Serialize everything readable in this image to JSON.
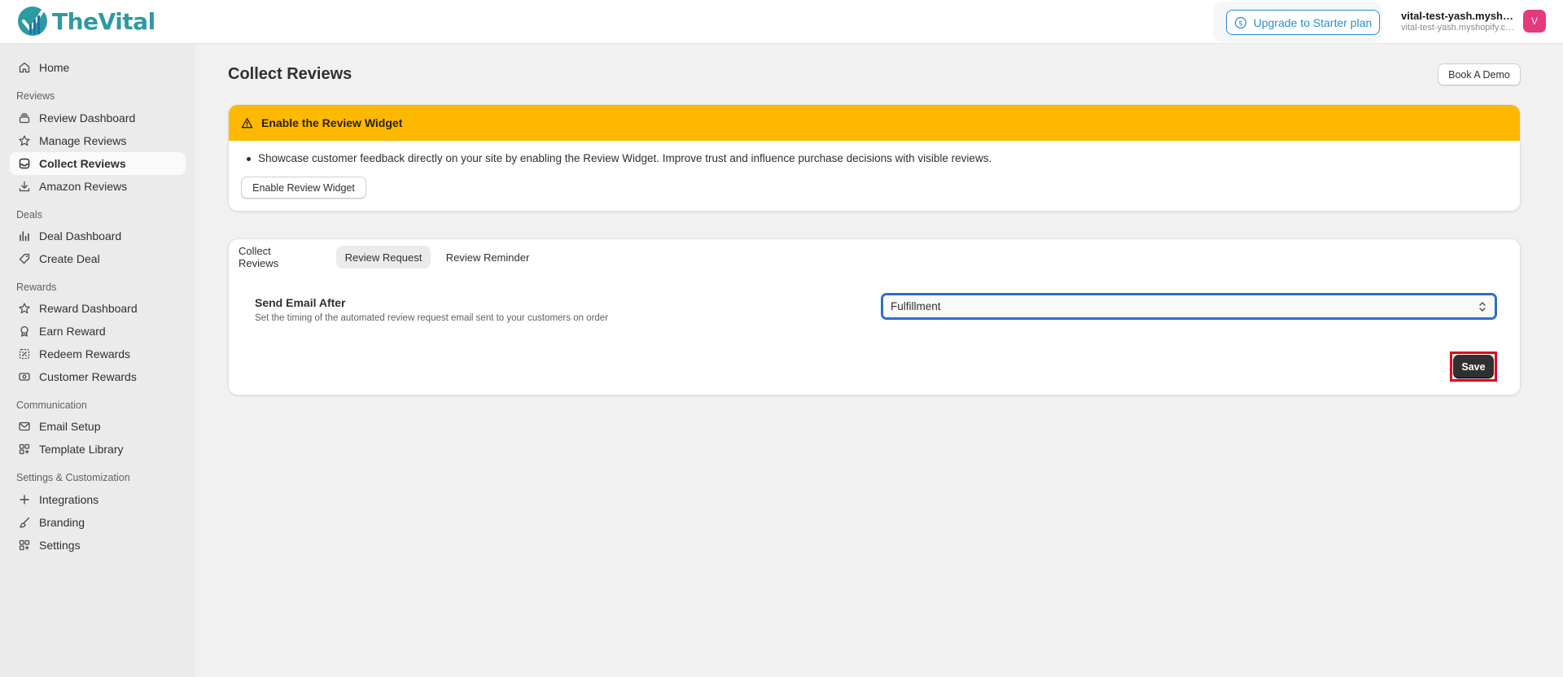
{
  "app": {
    "name": "TheVital"
  },
  "topbar": {
    "upgrade_label": "Upgrade to Starter plan",
    "store_name": "vital-test-yash.myshopify.com",
    "store_domain": "vital-test-yash.myshopify.com",
    "avatar_initial": "V"
  },
  "sidebar": {
    "home": "Home",
    "sections": {
      "reviews": "Reviews",
      "deals": "Deals",
      "rewards": "Rewards",
      "communication": "Communication",
      "settings": "Settings & Customization"
    },
    "items": {
      "review_dashboard": "Review Dashboard",
      "manage_reviews": "Manage Reviews",
      "collect_reviews": "Collect Reviews",
      "amazon_reviews": "Amazon Reviews",
      "deal_dashboard": "Deal Dashboard",
      "create_deal": "Create Deal",
      "reward_dashboard": "Reward Dashboard",
      "earn_reward": "Earn Reward",
      "redeem_rewards": "Redeem Rewards",
      "customer_rewards": "Customer Rewards",
      "email_setup": "Email Setup",
      "template_library": "Template Library",
      "integrations": "Integrations",
      "branding": "Branding",
      "settings": "Settings"
    },
    "active": "collect_reviews"
  },
  "page": {
    "title": "Collect Reviews",
    "book_demo": "Book A Demo"
  },
  "banner": {
    "title": "Enable the Review Widget",
    "text": "Showcase customer feedback directly on your site by enabling the Review Widget. Improve trust and influence purchase decisions with visible reviews.",
    "button": "Enable Review Widget",
    "color": "#ffb800"
  },
  "tabs": [
    {
      "label": "Collect Reviews",
      "active": false
    },
    {
      "label": "Review Request",
      "active": true
    },
    {
      "label": "Review Reminder",
      "active": false
    }
  ],
  "form": {
    "label": "Send Email After",
    "help": "Set the timing of the automated review request email sent to your customers on order",
    "select_value": "Fulfillment",
    "save": "Save"
  }
}
